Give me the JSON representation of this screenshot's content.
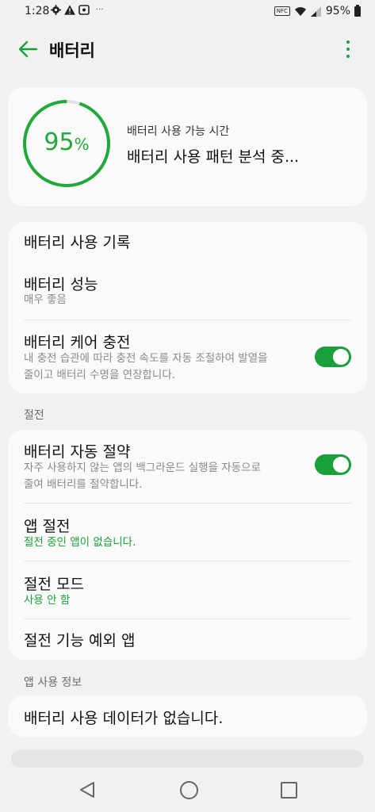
{
  "status_bar": {
    "time": "1:28",
    "battery_text": "95%",
    "nfc": "NFC",
    "dots": "···"
  },
  "app_bar": {
    "title": "배터리"
  },
  "battery_card": {
    "percent": "95",
    "percent_sign": "%",
    "level": 0.95,
    "label": "배터리 사용 가능 시간",
    "value": "배터리 사용 패턴 분석 중..."
  },
  "group1": {
    "usage_history": {
      "title": "배터리 사용 기록"
    },
    "performance": {
      "title": "배터리 성능",
      "subtitle": "매우 좋음"
    },
    "care_charging": {
      "title": "배터리 케어 충전",
      "subtitle_line1": "내 충전 습관에 따라 충전 속도를 자동 조절하여 발열을",
      "subtitle_line2": "줄이고 배터리 수명을 연장합니다.",
      "enabled": true
    }
  },
  "section_saving": "절전",
  "group2": {
    "auto_saving": {
      "title": "배터리 자동 절약",
      "subtitle_line1": "자주 사용하지 않는 앱의 백그라운드 실행을 자동으로",
      "subtitle_line2": "줄여 배터리를 절약합니다.",
      "enabled": true
    },
    "app_saving": {
      "title": "앱 절전",
      "subtitle": "절전 중인 앱이 없습니다."
    },
    "saving_mode": {
      "title": "절전 모드",
      "subtitle": "사용 안 함"
    },
    "exceptions": {
      "title": "절전 기능 예외 앱"
    }
  },
  "section_app_usage": "앱 사용 정보",
  "group3": {
    "no_data": "배터리 사용 데이터가 없습니다."
  },
  "colors": {
    "accent": "#1aa03a",
    "background": "#f1f1f1",
    "card": "#fafafa"
  }
}
